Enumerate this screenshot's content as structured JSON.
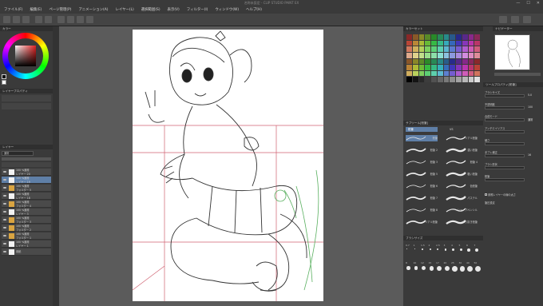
{
  "app": {
    "title": "名称未設定 - CLIP STUDIO PAINT EX",
    "menu": [
      "ファイル(F)",
      "編集(E)",
      "ページ管理(P)",
      "アニメーション(A)",
      "レイヤー(L)",
      "選択範囲(S)",
      "表示(V)",
      "フィルター(I)",
      "ウィンドウ(W)",
      "ヘルプ(H)"
    ]
  },
  "left_panel": {
    "color_panel_label": "カラー",
    "layer_property_title": "レイヤープロパティ",
    "layer_panel_title": "レイヤー",
    "blend_mode": "通常",
    "layers": [
      {
        "name": "レイヤー 20",
        "mode": "100 %通常",
        "selected": false
      },
      {
        "name": "レイヤー 19",
        "mode": "100 %通常",
        "selected": true
      },
      {
        "name": "フォルダー 5",
        "mode": "100 %通常",
        "selected": false
      },
      {
        "name": "レイヤー 18",
        "mode": "100 %通常",
        "selected": false
      },
      {
        "name": "フォルダー 4",
        "mode": "100 %通常",
        "selected": false
      },
      {
        "name": "レイヤー 3",
        "mode": "100 %通常",
        "selected": false
      },
      {
        "name": "フォルダー 3",
        "mode": "100 %通常",
        "selected": false
      },
      {
        "name": "フォルダー 2",
        "mode": "100 %通常",
        "selected": false
      },
      {
        "name": "フォルダー 1",
        "mode": "100 %通常",
        "selected": false
      },
      {
        "name": "レイヤー 1",
        "mode": "100 %通常",
        "selected": false
      },
      {
        "name": "用紙",
        "mode": "",
        "selected": false
      }
    ]
  },
  "right_panel": {
    "color_set_title": "カラーセット",
    "navigator_title": "ナビゲーター",
    "sub_tool_title": "サブツール[鉛筆]",
    "sub_tool_tabs": [
      "鉛筆",
      "VS"
    ],
    "brushes": [
      {
        "label": "鉛筆"
      },
      {
        "label": "リアル鉛筆"
      },
      {
        "label": "鉛筆 2"
      },
      {
        "label": "濃い鉛筆"
      },
      {
        "label": "鉛筆 3"
      },
      {
        "label": "鉛筆 4"
      },
      {
        "label": "鉛筆 5"
      },
      {
        "label": "粗い鉛筆"
      },
      {
        "label": "鉛筆 6"
      },
      {
        "label": "色鉛筆"
      },
      {
        "label": "鉛筆 7"
      },
      {
        "label": "パステル"
      },
      {
        "label": "鉛筆 8"
      },
      {
        "label": "シャープペンシル"
      },
      {
        "label": "リアル鉛筆"
      },
      {
        "label": "入り抜き鉛筆"
      }
    ],
    "brush_size_title": "ブラシサイズ",
    "brush_sizes": [
      "0.7",
      "1",
      "1.5",
      "2",
      "2.5",
      "3",
      "4",
      "5",
      "6",
      "7",
      "8",
      "10",
      "12",
      "15",
      "17",
      "20",
      "25",
      "30",
      "40",
      "50"
    ],
    "tool_property_title": "ツールプロパティ[鉛筆]",
    "properties": [
      {
        "label": "ブラシサイズ",
        "value": "5.0"
      },
      {
        "label": "不透明度",
        "value": "100"
      },
      {
        "label": "合成モード",
        "value": "通常"
      },
      {
        "label": "アンチエイリアス",
        "value": ""
      },
      {
        "label": "硬さ",
        "value": ""
      },
      {
        "label": "手ブレ補正",
        "value": "16"
      },
      {
        "label": "ブラシ形状",
        "value": ""
      },
      {
        "label": "鉛筆",
        "value": ""
      }
    ],
    "checkbox_label": "参照レイヤーの線の太さ",
    "footer_label": "筆圧設定"
  },
  "accent": "#5f7fa7",
  "canvas": {
    "bg": "#ffffff"
  }
}
